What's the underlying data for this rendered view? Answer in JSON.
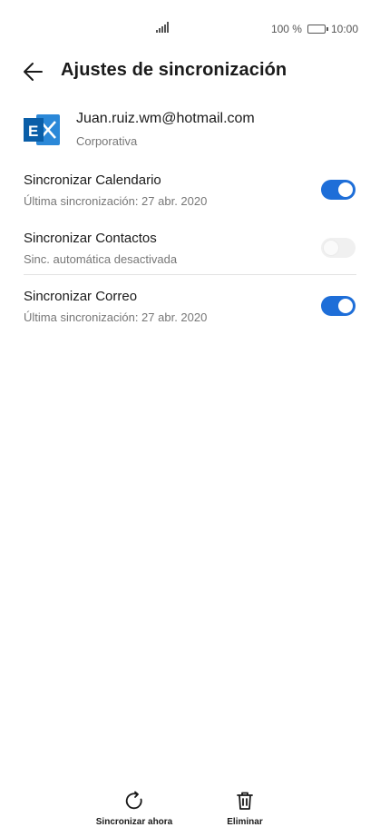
{
  "status": {
    "battery_text": "100 %",
    "time": "10:00"
  },
  "header": {
    "title": "Ajustes de sincronización",
    "back_icon": "arrow-left-icon"
  },
  "account": {
    "email": "Juan.ruiz.wm@hotmail.com",
    "type": "Corporativa",
    "logo_icon": "exchange-logo-icon",
    "brand_color": "#0a6bc2"
  },
  "sync_items": [
    {
      "label": "Sincronizar Calendario",
      "sub": "Última sincronización: 27 abr. 2020",
      "enabled": true
    },
    {
      "label": "Sincronizar Contactos",
      "sub": "Sinc. automática desactivada",
      "enabled": false
    },
    {
      "label": "Sincronizar Correo",
      "sub": "Última sincronización: 27 abr. 2020",
      "enabled": true
    }
  ],
  "bottom": {
    "sync_now_label": "Sincronizar ahora",
    "sync_now_icon": "refresh-icon",
    "delete_label": "Eliminar",
    "delete_icon": "trash-icon"
  },
  "colors": {
    "accent": "#1e6ed8",
    "toggle_off": "#f0f0f0",
    "text_primary": "#1a1a1a",
    "text_secondary": "#777777"
  }
}
